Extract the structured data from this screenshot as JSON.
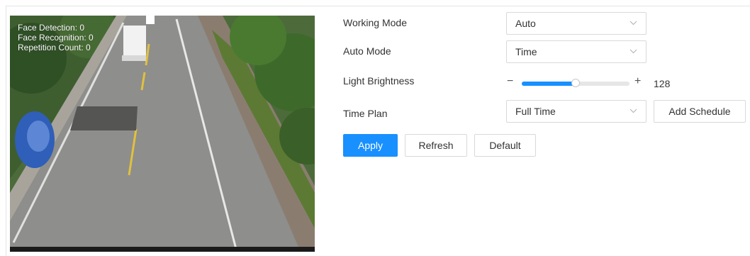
{
  "colors": {
    "primary": "#1890ff",
    "slider_track": "#e6e6e6",
    "border": "#d9d9d9",
    "text": "#333333"
  },
  "video": {
    "overlay": {
      "face_detection": "Face Detection: 0",
      "face_recognition": "Face Recognition: 0",
      "repetition_count": "Repetition Count: 0"
    }
  },
  "form": {
    "working_mode": {
      "label": "Working Mode",
      "value": "Auto"
    },
    "auto_mode": {
      "label": "Auto Mode",
      "value": "Time"
    },
    "light_brightness": {
      "label": "Light Brightness",
      "minus": "−",
      "plus": "+",
      "value": "128",
      "fraction": 0.5
    },
    "time_plan": {
      "label": "Time Plan",
      "value": "Full Time",
      "add_schedule": "Add Schedule"
    }
  },
  "actions": {
    "apply": "Apply",
    "refresh": "Refresh",
    "default": "Default"
  }
}
